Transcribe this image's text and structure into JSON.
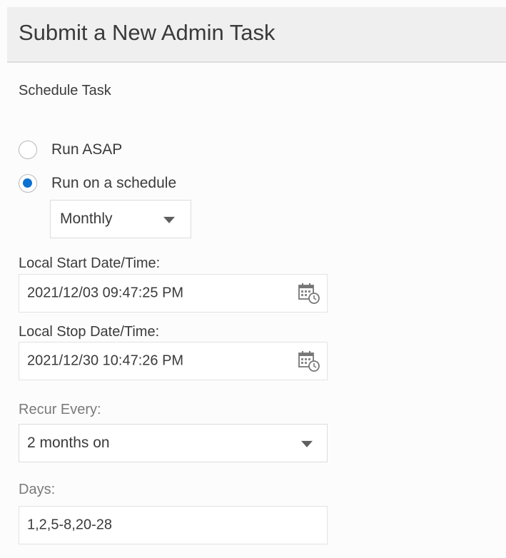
{
  "header": {
    "title": "Submit a New Admin Task"
  },
  "section": {
    "title": "Schedule Task"
  },
  "run_options": [
    {
      "label": "Run ASAP",
      "checked": false
    },
    {
      "label": "Run on a schedule",
      "checked": true
    }
  ],
  "frequency": {
    "value": "Monthly"
  },
  "start": {
    "label": "Local Start Date/Time:",
    "value": "2021/12/03 09:47:25 PM"
  },
  "stop": {
    "label": "Local Stop Date/Time:",
    "value": "2021/12/30 10:47:26 PM"
  },
  "recur": {
    "label": "Recur Every:",
    "value": "2 months on"
  },
  "days": {
    "label": "Days:",
    "value": "1,2,5-8,20-28"
  },
  "icons": {
    "calendar": "calendar-clock-icon",
    "dropdown": "chevron-down-icon"
  },
  "colors": {
    "accent": "#0b72d1",
    "header_background": "#efefef",
    "border": "#dcdcdc"
  }
}
